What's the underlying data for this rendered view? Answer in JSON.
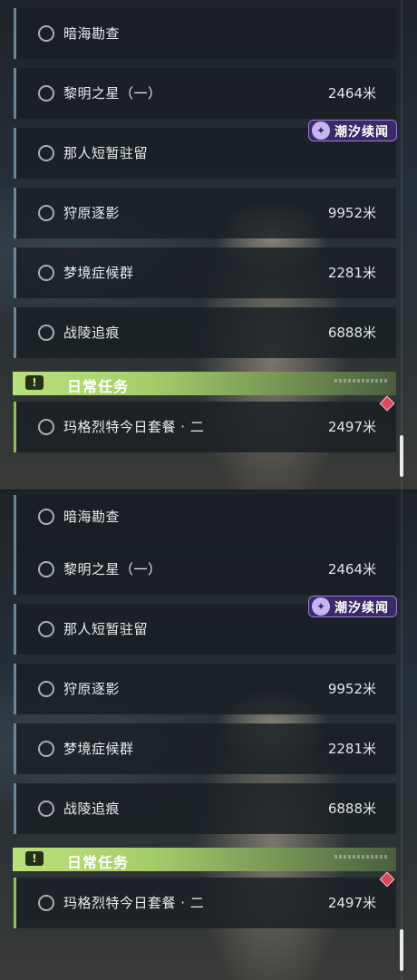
{
  "quests": [
    {
      "name": "暗海勘查",
      "distance": ""
    },
    {
      "name": "黎明之星（一）",
      "distance": "2464米"
    },
    {
      "name": "那人短暂驻留",
      "distance": ""
    },
    {
      "name": "狩原逐影",
      "distance": "9952米"
    },
    {
      "name": "梦境症候群",
      "distance": "2281米"
    },
    {
      "name": "战陵追痕",
      "distance": "6888米"
    }
  ],
  "daily": {
    "badge": "!",
    "title": "日常任务",
    "quest": {
      "name": "玛格烈特今日套餐 · 二",
      "distance": "2497米"
    }
  },
  "event_tag": {
    "label": "潮汐续闻",
    "icon": "event-logo-icon",
    "color": "#3b2a63"
  },
  "colors": {
    "accent_daily": "#a6cf6c",
    "row_border": "#6b8697",
    "alert": "#d84a5a"
  }
}
